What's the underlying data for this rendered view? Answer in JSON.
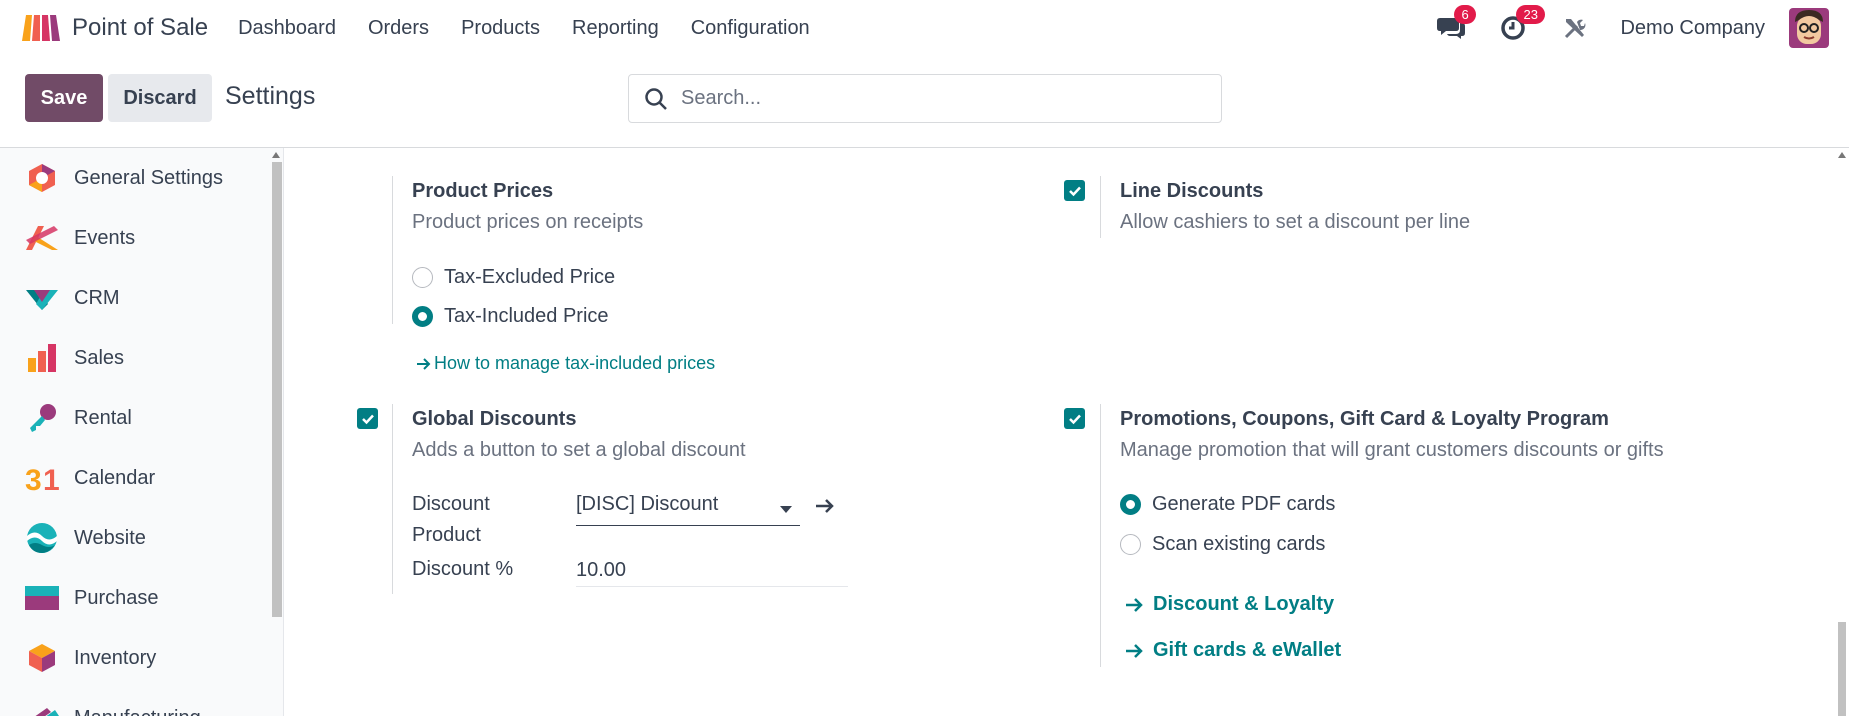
{
  "navbar": {
    "app_title": "Point of Sale",
    "menu": [
      "Dashboard",
      "Orders",
      "Products",
      "Reporting",
      "Configuration"
    ],
    "messages_count": "6",
    "activities_count": "23",
    "company": "Demo Company",
    "icons": [
      "pos-logo-icon",
      "chat-icon",
      "clock-icon",
      "tools-icon"
    ]
  },
  "control_panel": {
    "save_label": "Save",
    "discard_label": "Discard",
    "title": "Settings",
    "search_placeholder": "Search..."
  },
  "sidebar": {
    "items": [
      {
        "label": "General Settings",
        "icon": "general-settings-icon"
      },
      {
        "label": "Events",
        "icon": "events-icon"
      },
      {
        "label": "CRM",
        "icon": "crm-icon"
      },
      {
        "label": "Sales",
        "icon": "sales-icon"
      },
      {
        "label": "Rental",
        "icon": "rental-icon"
      },
      {
        "label": "Calendar",
        "icon": "calendar-icon"
      },
      {
        "label": "Website",
        "icon": "website-icon"
      },
      {
        "label": "Purchase",
        "icon": "purchase-icon"
      },
      {
        "label": "Inventory",
        "icon": "inventory-icon"
      },
      {
        "label": "Manufacturing",
        "icon": "manufacturing-icon"
      }
    ]
  },
  "settings": {
    "product_prices": {
      "title": "Product Prices",
      "description": "Product prices on receipts",
      "options": [
        "Tax-Excluded Price",
        "Tax-Included Price"
      ],
      "selected": "Tax-Included Price",
      "link": "How to manage tax-included prices"
    },
    "line_discounts": {
      "title": "Line Discounts",
      "description": "Allow cashiers to set a discount per line",
      "checked": true
    },
    "global_discounts": {
      "title": "Global Discounts",
      "description": "Adds a button to set a global discount",
      "checked": true,
      "discount_product_label_1": "Discount",
      "discount_product_label_2": "Product",
      "discount_product_value": "[DISC] Discount",
      "discount_pct_label": "Discount %",
      "discount_pct_value": "10.00"
    },
    "promotions": {
      "title": "Promotions, Coupons, Gift Card & Loyalty Program",
      "description": "Manage promotion that will grant customers discounts or gifts",
      "checked": true,
      "options": [
        "Generate PDF cards",
        "Scan existing cards"
      ],
      "selected": "Generate PDF cards",
      "links": [
        "Discount & Loyalty",
        "Gift cards & eWallet"
      ]
    }
  },
  "colors": {
    "primary": "#714b67",
    "accent": "#017e84",
    "badge": "#e21b4a"
  }
}
